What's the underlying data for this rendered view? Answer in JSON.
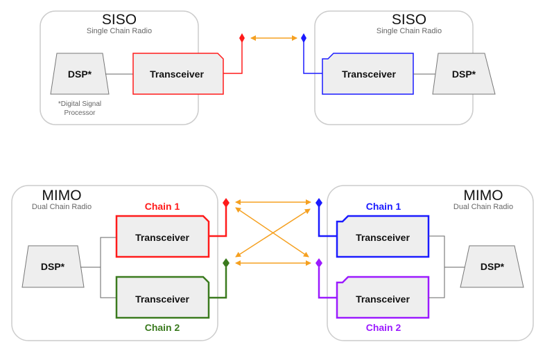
{
  "colors": {
    "red": "#ff1a1a",
    "blue": "#1a1aff",
    "green": "#3a7a1e",
    "purple": "#9b1aff",
    "arrow": "#f5a020",
    "panel_border": "#cccccc",
    "box_fill": "#eeeeee",
    "connector": "#666666"
  },
  "siso_left": {
    "title": "SISO",
    "subtitle": "Single Chain Radio",
    "dsp_label": "DSP*",
    "transceiver_label": "Transceiver",
    "footnote_line1": "*Digital Signal",
    "footnote_line2": "Processor"
  },
  "siso_right": {
    "title": "SISO",
    "subtitle": "Single Chain Radio",
    "dsp_label": "DSP*",
    "transceiver_label": "Transceiver"
  },
  "mimo_left": {
    "title": "MIMO",
    "subtitle": "Dual Chain Radio",
    "dsp_label": "DSP*",
    "chain1_label": "Chain 1",
    "chain2_label": "Chain 2",
    "transceiver1_label": "Transceiver",
    "transceiver2_label": "Transceiver"
  },
  "mimo_right": {
    "title": "MIMO",
    "subtitle": "Dual Chain Radio",
    "dsp_label": "DSP*",
    "chain1_label": "Chain 1",
    "chain2_label": "Chain 2",
    "transceiver1_label": "Transceiver",
    "transceiver2_label": "Transceiver"
  }
}
